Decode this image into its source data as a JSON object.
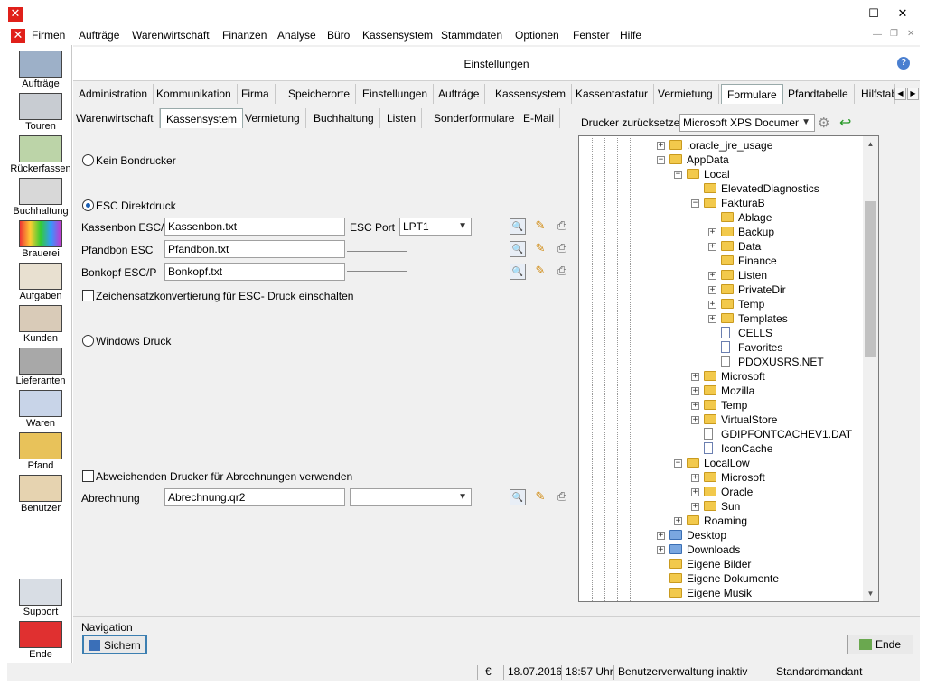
{
  "window": {
    "minimize": "—",
    "maximize": "☐",
    "close": "✕"
  },
  "menu": [
    "Firmen",
    "Aufträge",
    "Warenwirtschaft",
    "Finanzen",
    "Analyse",
    "Büro",
    "Kassensystem",
    "Stammdaten",
    "Optionen",
    "Fenster",
    "Hilfe"
  ],
  "sidebar": [
    {
      "label": "Aufträge",
      "icon": "headset-person-icon"
    },
    {
      "label": "Touren",
      "icon": "truck-icon"
    },
    {
      "label": "Rückerfassen",
      "icon": "clipboard-check-icon"
    },
    {
      "label": "Buchhaltung",
      "icon": "ledger-icon"
    },
    {
      "label": "Brauerei",
      "icon": "color-wheel-icon"
    },
    {
      "label": "Aufgaben",
      "icon": "tasks-icon"
    },
    {
      "label": "Kunden",
      "icon": "customers-icon"
    },
    {
      "label": "Lieferanten",
      "icon": "warehouse-icon"
    },
    {
      "label": "Waren",
      "icon": "products-icon"
    },
    {
      "label": "Pfand",
      "icon": "crate-icon"
    },
    {
      "label": "Benutzer",
      "icon": "user-lock-icon"
    },
    {
      "label": "Support",
      "icon": "handshake-icon"
    },
    {
      "label": "Ende",
      "icon": "power-icon"
    }
  ],
  "header": {
    "title": "Einstellungen"
  },
  "tabs1": [
    "Administration",
    "Kommunikation",
    "Firma",
    "Speicherorte",
    "Einstellungen",
    "Aufträge",
    "Kassensystem",
    "Kassentastatur",
    "Vermietung",
    "Formulare",
    "Pfandtabelle",
    "Hilfstab"
  ],
  "tabs2": [
    "Warenwirtschaft",
    "Kassensystem",
    "Vermietung",
    "Buchhaltung",
    "Listen",
    "Sonderformulare",
    "E-Mail"
  ],
  "printer_reset": {
    "label": "Drucker zurücksetzen:",
    "value": "Microsoft XPS Document W"
  },
  "form": {
    "kein_bondrucker": "Kein Bondrucker",
    "esc_direktdruck": "ESC Direktdruck",
    "kassenbon_label": "Kassenbon ESC/P",
    "kassenbon_value": "Kassenbon.txt",
    "esc_port_label": "ESC Port",
    "esc_port_value": "LPT1",
    "pfandbon_label": "Pfandbon ESC",
    "pfandbon_value": "Pfandbon.txt",
    "bonkopf_label": "Bonkopf ESC/P",
    "bonkopf_value": "Bonkopf.txt",
    "zeichensatz": "Zeichensatzkonvertierung für ESC- Druck einschalten",
    "windows_druck": "Windows Druck",
    "abweichend": "Abweichenden Drucker für Abrechnungen verwenden",
    "abrechnung_label": "Abrechnung",
    "abrechnung_value": "Abrechnung.qr2",
    "abrechnung_printer": ""
  },
  "tree": [
    {
      "label": ".oracle_jre_usage",
      "depth": 0,
      "exp": "+",
      "type": "folder"
    },
    {
      "label": "AppData",
      "depth": 0,
      "exp": "-",
      "type": "folder"
    },
    {
      "label": "Local",
      "depth": 1,
      "exp": "-",
      "type": "folder"
    },
    {
      "label": "ElevatedDiagnostics",
      "depth": 2,
      "exp": "",
      "type": "folder"
    },
    {
      "label": "FakturaB",
      "depth": 2,
      "exp": "-",
      "type": "folder"
    },
    {
      "label": "Ablage",
      "depth": 3,
      "exp": "",
      "type": "folder"
    },
    {
      "label": "Backup",
      "depth": 3,
      "exp": "+",
      "type": "folder"
    },
    {
      "label": "Data",
      "depth": 3,
      "exp": "+",
      "type": "folder"
    },
    {
      "label": "Finance",
      "depth": 3,
      "exp": "",
      "type": "folder"
    },
    {
      "label": "Listen",
      "depth": 3,
      "exp": "+",
      "type": "folder"
    },
    {
      "label": "PrivateDir",
      "depth": 3,
      "exp": "+",
      "type": "folder"
    },
    {
      "label": "Temp",
      "depth": 3,
      "exp": "+",
      "type": "folder"
    },
    {
      "label": "Templates",
      "depth": 3,
      "exp": "+",
      "type": "folder"
    },
    {
      "label": "CELLS",
      "depth": 3,
      "exp": "",
      "type": "gear"
    },
    {
      "label": "Favorites",
      "depth": 3,
      "exp": "",
      "type": "gear"
    },
    {
      "label": "PDOXUSRS.NET",
      "depth": 3,
      "exp": "",
      "type": "file"
    },
    {
      "label": "Microsoft",
      "depth": 2,
      "exp": "+",
      "type": "folder"
    },
    {
      "label": "Mozilla",
      "depth": 2,
      "exp": "+",
      "type": "folder"
    },
    {
      "label": "Temp",
      "depth": 2,
      "exp": "+",
      "type": "folder"
    },
    {
      "label": "VirtualStore",
      "depth": 2,
      "exp": "+",
      "type": "folder"
    },
    {
      "label": "GDIPFONTCACHEV1.DAT",
      "depth": 2,
      "exp": "",
      "type": "file"
    },
    {
      "label": "IconCache",
      "depth": 2,
      "exp": "",
      "type": "gear"
    },
    {
      "label": "LocalLow",
      "depth": 1,
      "exp": "-",
      "type": "folder"
    },
    {
      "label": "Microsoft",
      "depth": 2,
      "exp": "+",
      "type": "folder"
    },
    {
      "label": "Oracle",
      "depth": 2,
      "exp": "+",
      "type": "folder"
    },
    {
      "label": "Sun",
      "depth": 2,
      "exp": "+",
      "type": "folder"
    },
    {
      "label": "Roaming",
      "depth": 1,
      "exp": "+",
      "type": "folder"
    },
    {
      "label": "Desktop",
      "depth": 0,
      "exp": "+",
      "type": "bluefolder"
    },
    {
      "label": "Downloads",
      "depth": 0,
      "exp": "+",
      "type": "bluefolder"
    },
    {
      "label": "Eigene Bilder",
      "depth": 0,
      "exp": "",
      "type": "folder"
    },
    {
      "label": "Eigene Dokumente",
      "depth": 0,
      "exp": "",
      "type": "folder"
    },
    {
      "label": "Eigene Musik",
      "depth": 0,
      "exp": "",
      "type": "folder"
    }
  ],
  "navigation": {
    "label": "Navigation",
    "save": "Sichern",
    "end": "Ende"
  },
  "status": {
    "currency": "€",
    "date": "18.07.2016",
    "time": "18:57 Uhr",
    "user": "Benutzerverwaltung inaktiv",
    "mandant": "Standardmandant"
  }
}
